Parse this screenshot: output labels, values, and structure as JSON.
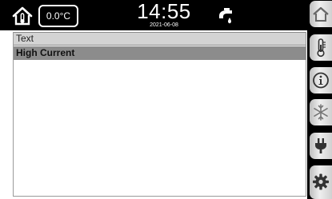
{
  "status_bar": {
    "outdoor_temperature": "0.0°C",
    "time": "14:55",
    "date": "2021-06-08"
  },
  "list": {
    "header": "Text",
    "rows": [
      "High Current"
    ]
  },
  "side_menu": {
    "icons": [
      "home-icon",
      "thermometer-icon",
      "info-icon",
      "snowflake-icon",
      "plug-icon",
      "gear-icon"
    ]
  },
  "colors": {
    "bar_background": "#000000",
    "header_background": "#d3d3d3",
    "selected_row": "#8c8c8c"
  }
}
